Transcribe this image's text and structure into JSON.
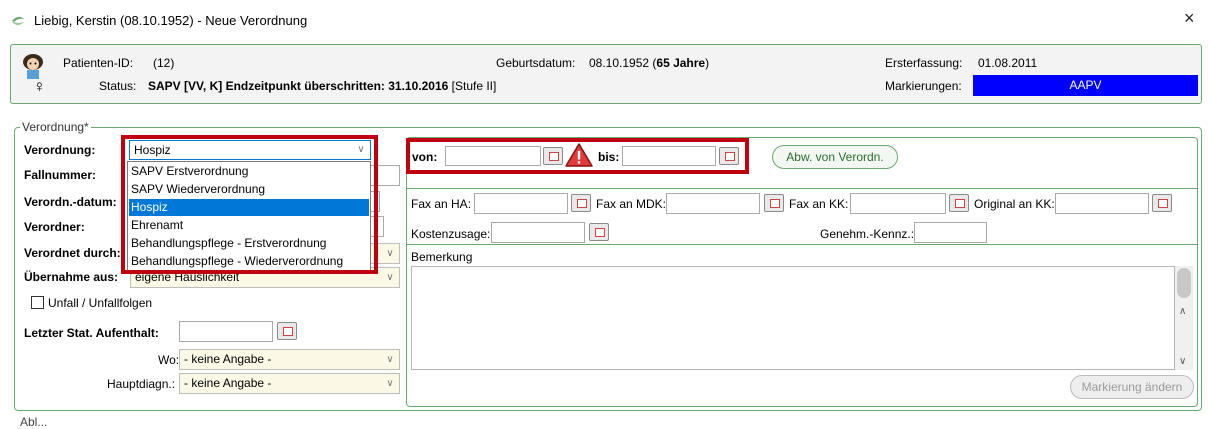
{
  "window": {
    "title": "Liebig, Kerstin (08.10.1952) - Neue Verordnung",
    "close_icon": "×"
  },
  "patient": {
    "id_label": "Patienten-ID:",
    "id_value": "(12)",
    "status_label": "Status:",
    "status_value": "SAPV [VV, K] Endzeitpunkt überschritten: 31.10.2016",
    "status_suffix": " [Stufe II]",
    "gender_symbol": "♀",
    "birth_label": "Geburtsdatum:",
    "birth_value": "08.10.1952 (",
    "birth_age": "65 Jahre",
    "birth_close": ")",
    "erst_label": "Ersterfassung:",
    "erst_value": "01.08.2011",
    "mark_label": "Markierungen:",
    "mark_value": "AAPV",
    "mark_color": "#0000ff"
  },
  "group": {
    "legend": "Verordnung*"
  },
  "form": {
    "verordnung_label": "Verordnung:",
    "verordnung_value": "Hospiz",
    "fallnummer_label": "Fallnummer:",
    "datum_label": "Verordn.-datum:",
    "verordner_label": "Verordner:",
    "durch_label": "Verordnet durch:",
    "uebernahme_label": "Übernahme aus:",
    "uebernahme_value": "eigene Häuslichkeit",
    "unfall_label": "Unfall / Unfallfolgen",
    "stat_label": "Letzter Stat. Aufenthalt:",
    "wo_label": "Wo:",
    "wo_value": "- keine Angabe -",
    "diag_label": "Hauptdiagn.:",
    "diag_value": "- keine Angabe -"
  },
  "dropdown": {
    "options": [
      "SAPV Erstverordnung",
      "SAPV Wiederverordnung",
      "Hospiz",
      "Ehrenamt",
      "Behandlungspflege - Erstverordnung",
      "Behandlungspflege - Wiederverordnung"
    ],
    "selected_index": 2
  },
  "right": {
    "von_label": "von:",
    "bis_label": "bis:",
    "abw_button": "Abw. von Verordn.",
    "fax_ha_label": "Fax an HA:",
    "fax_mdk_label": "Fax an MDK:",
    "fax_kk_label": "Fax an KK:",
    "original_kk_label": "Original an KK:",
    "kostenzusage_label": "Kostenzusage:",
    "genehm_label": "Genehm.-Kennz.:",
    "bemerkung_label": "Bemerkung",
    "markierung_button": "Markierung ändern"
  },
  "footer": {
    "partial_text": "Abl..."
  },
  "colors": {
    "highlight_red": "#c0000f",
    "group_green": "#6aa96e",
    "selection_blue": "#0078d7"
  }
}
